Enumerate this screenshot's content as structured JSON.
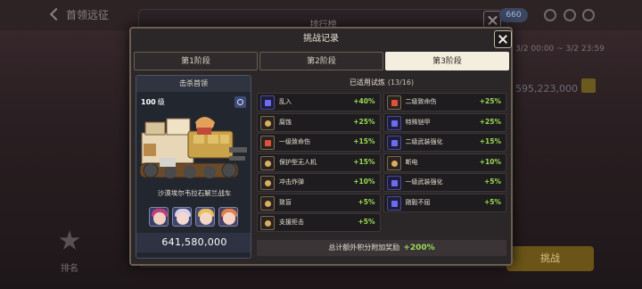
{
  "background": {
    "back_label": "首领远征",
    "panel_title": "排行榜",
    "currency": "660",
    "date_range": "3/2 00:00 ~ 3/2 23:59",
    "score": "595,223,000",
    "challenge_button": "挑战",
    "rank_label": "排名"
  },
  "modal": {
    "title": "挑战记录",
    "tabs": [
      {
        "label": "第1阶段",
        "active": false
      },
      {
        "label": "第2阶段",
        "active": false
      },
      {
        "label": "第3阶段",
        "active": true
      }
    ]
  },
  "boss": {
    "header": "击杀首领",
    "level_num": "100",
    "level_unit": "级",
    "name": "沙漠埃尔韦拉石解兰战车",
    "score": "641,580,000"
  },
  "trials": {
    "header": "已适用试炼",
    "count": "(13/16)",
    "items": [
      {
        "name": "乱入",
        "pct": "+40%",
        "style": "purple"
      },
      {
        "name": "二级致命伤",
        "pct": "+25%",
        "style": "red"
      },
      {
        "name": "腐蚀",
        "pct": "+25%",
        "style": "gold"
      },
      {
        "name": "特殊铠甲",
        "pct": "+25%",
        "style": "purple"
      },
      {
        "name": "一级致命伤",
        "pct": "+15%",
        "style": "red"
      },
      {
        "name": "二级武装强化",
        "pct": "+15%",
        "style": "purple"
      },
      {
        "name": "保护型无人机",
        "pct": "+15%",
        "style": "gold"
      },
      {
        "name": "断电",
        "pct": "+10%",
        "style": "gold"
      },
      {
        "name": "冲击炸弹",
        "pct": "+10%",
        "style": "gold"
      },
      {
        "name": "一级武装强化",
        "pct": "+5%",
        "style": "purple"
      },
      {
        "name": "致盲",
        "pct": "+5%",
        "style": "gold"
      },
      {
        "name": "刚毅不屈",
        "pct": "+5%",
        "style": "purple"
      },
      {
        "name": "支援拒击",
        "pct": "+5%",
        "style": "gold"
      }
    ],
    "total_label": "总计额外积分附加奖励",
    "total_value": "+200%"
  }
}
